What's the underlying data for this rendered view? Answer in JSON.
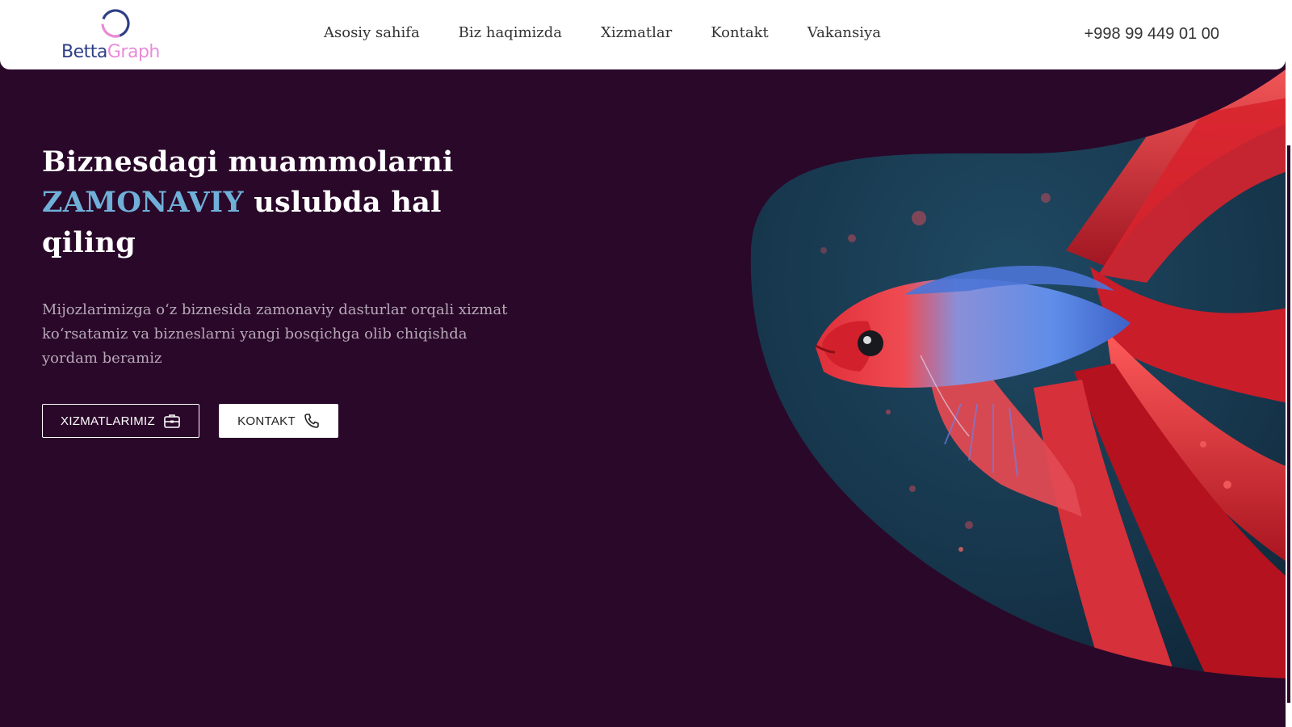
{
  "brand": {
    "logo_part1": "Betta",
    "logo_part2": "Graph",
    "ring_colors": [
      "#2f3f86",
      "#e98bd7"
    ]
  },
  "nav": {
    "items": [
      "Asosiy sahifa",
      "Biz haqimizda",
      "Xizmatlar",
      "Kontakt",
      "Vakansiya"
    ],
    "phone": "+998 99 449 01 00"
  },
  "hero": {
    "title_line1": "Biznesdagi muammolarni",
    "title_accent": "ZAMONAVIY",
    "title_rest": "uslubda hal",
    "title_line3": "qiling",
    "description": "Mijozlarimizga o‘z biznesida zamonaviy dasturlar orqali xizmat ko‘rsatamiz va bizneslarni yangi bosqichga olib chiqishda yordam beramiz",
    "buttons": {
      "services": "XIZMATLARIMIZ",
      "contact": "KONTAKT"
    },
    "image_alt": "betta-fish-illustration"
  },
  "icons": {
    "services_icon": "briefcase-icon",
    "contact_icon": "phone-icon"
  },
  "colors": {
    "background": "#2a0829",
    "accent": "#6fb0d8",
    "nav_bg": "#ffffff",
    "text_light": "#ffffff",
    "text_muted": "#b6a9b8"
  }
}
